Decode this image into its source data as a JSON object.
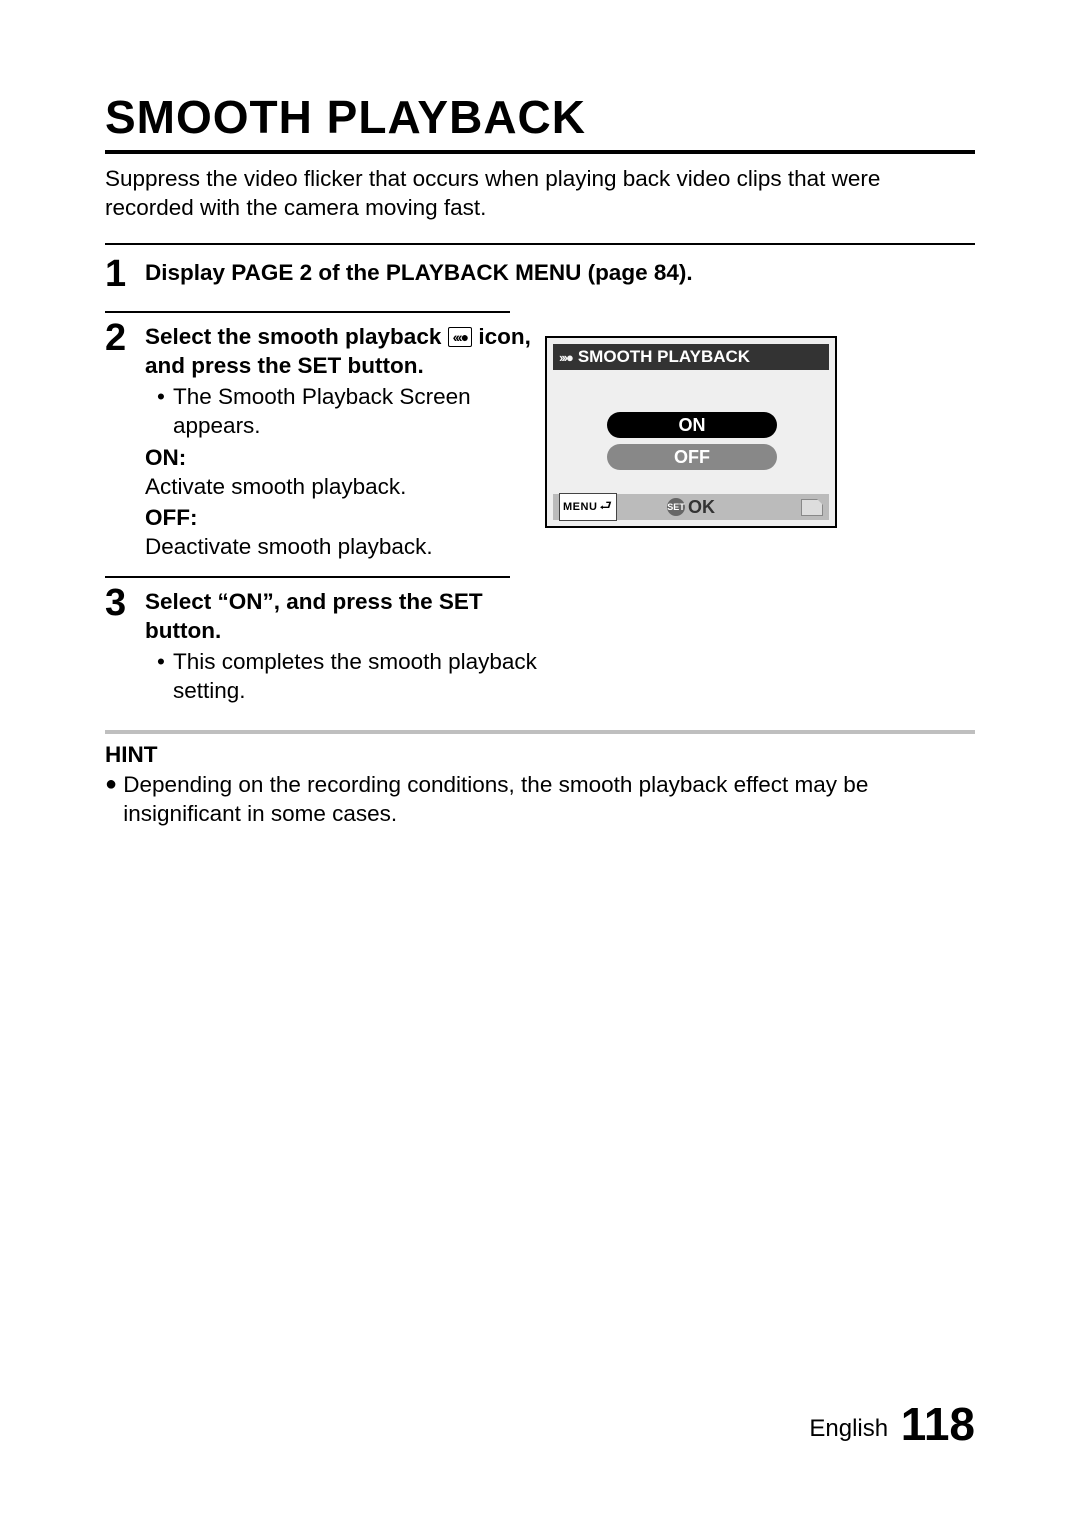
{
  "title": "SMOOTH PLAYBACK",
  "intro": "Suppress the video flicker that occurs when playing back video clips that were recorded with the camera moving fast.",
  "steps": [
    {
      "num": "1",
      "headline": "Display PAGE 2 of the PLAYBACK MENU (page 84)."
    },
    {
      "num": "2",
      "headline_pre": "Select the smooth playback ",
      "headline_post": " icon, and press the SET button.",
      "icon_glyph": "‹‹‹●",
      "bullet": "The Smooth Playback Screen appears.",
      "defs": [
        {
          "label": "ON:",
          "text": "Activate smooth playback."
        },
        {
          "label": "OFF:",
          "text": "Deactivate smooth playback."
        }
      ]
    },
    {
      "num": "3",
      "headline": "Select “ON”, and press the SET button.",
      "bullet": "This completes the smooth playback setting."
    }
  ],
  "screen": {
    "title": "SMOOTH PLAYBACK",
    "icon_glyph": "›››●",
    "option_on": "ON",
    "option_off": "OFF",
    "menu_label": "MENU",
    "set_label": "SET",
    "ok_label": "OK"
  },
  "hint": {
    "label": "HINT",
    "text": "Depending on the recording conditions, the smooth playback effect may be insignificant in some cases."
  },
  "footer": {
    "language": "English",
    "page_number": "118"
  }
}
